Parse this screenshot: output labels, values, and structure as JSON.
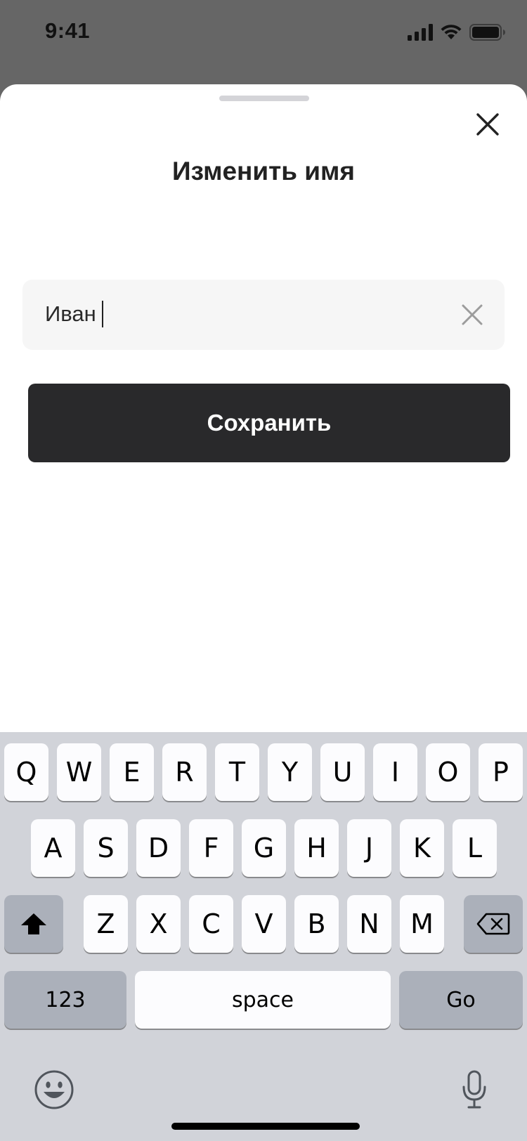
{
  "status_bar": {
    "time": "9:41",
    "icons": [
      "cellular-signal-icon",
      "wifi-icon",
      "battery-icon"
    ]
  },
  "sheet": {
    "title": "Изменить имя",
    "close_icon": "close-icon",
    "name_field": {
      "value": "Иван",
      "clear_icon": "clear-icon"
    },
    "save_button": "Сохранить"
  },
  "keyboard": {
    "row1": [
      "Q",
      "W",
      "E",
      "R",
      "T",
      "Y",
      "U",
      "I",
      "O",
      "P"
    ],
    "row2": [
      "A",
      "S",
      "D",
      "F",
      "G",
      "H",
      "J",
      "K",
      "L"
    ],
    "row3": [
      "Z",
      "X",
      "C",
      "V",
      "B",
      "N",
      "M"
    ],
    "shift_icon": "shift-icon",
    "delete_icon": "backspace-icon",
    "numbers_label": "123",
    "space_label": "space",
    "go_label": "Go",
    "emoji_icon": "emoji-icon",
    "mic_icon": "microphone-icon"
  },
  "colors": {
    "dim_background": "#666666",
    "sheet_background": "#ffffff",
    "field_background": "#f6f6f6",
    "button_background": "#29292b",
    "keyboard_background": "#d1d3d9"
  }
}
